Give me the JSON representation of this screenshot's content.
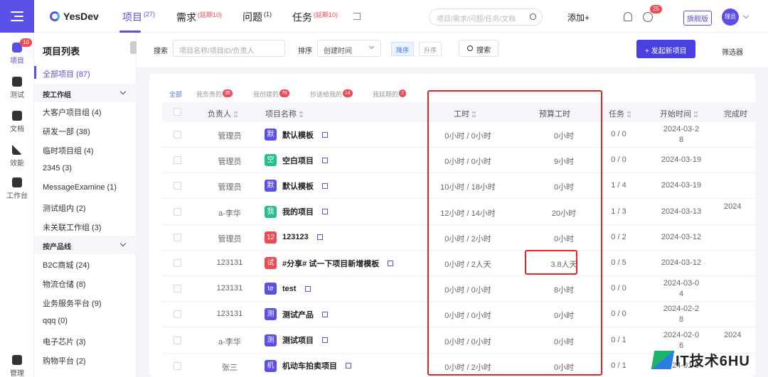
{
  "rail": {
    "project_badge": "10",
    "items": [
      {
        "label": "项目"
      },
      {
        "label": "测试"
      },
      {
        "label": "文档"
      },
      {
        "label": "效能"
      },
      {
        "label": "工作台"
      },
      {
        "label": "管理"
      }
    ]
  },
  "topbar": {
    "logo": "YesDev",
    "tabs": [
      {
        "label": "项目",
        "sup": "(27)"
      },
      {
        "label": "需求",
        "sup": "(延期10)"
      },
      {
        "label": "问题",
        "sup": "(1)"
      },
      {
        "label": "任务",
        "sup": "(延期10)"
      }
    ],
    "search_placeholder": "项目/需求/问题/任务/文档",
    "add_label": "添加+",
    "clock_badge": "25",
    "flagship_label": "旗舰版",
    "avatar_text": "理员"
  },
  "project_panel": {
    "title": "项目列表",
    "all_label": "全部项目 (87)",
    "group_work": "按工作组",
    "work_items": [
      "大客户项目组 (4)",
      "研发一部 (38)",
      "临时项目组 (4)",
      "2345 (3)",
      "MessageExamine (1)",
      "测试组内 (2)",
      "未关联工作组 (3)"
    ],
    "group_product": "按产品线",
    "product_items": [
      "B2C商城 (24)",
      "物流仓储 (8)",
      "业务服务平台 (9)",
      "qqq (0)",
      "电子芯片 (3)",
      "购物平台 (2)"
    ]
  },
  "filter": {
    "search_label": "搜索",
    "search_placeholder": "项目名称/项目ID/负责人",
    "sort_label": "排序",
    "sort_value": "创建时间",
    "desc_label": "降序",
    "asc_label": "升序",
    "search_button": "搜索",
    "new_project_button": "+ 发起新项目",
    "filter_label": "筛选器"
  },
  "subtabs": [
    {
      "label": "全部",
      "badge": ""
    },
    {
      "label": "我负责的",
      "badge": "35"
    },
    {
      "label": "我创建的",
      "badge": "76"
    },
    {
      "label": "抄送给我的",
      "badge": "14"
    },
    {
      "label": "我延期的",
      "badge": "2"
    }
  ],
  "table": {
    "headers": {
      "owner": "负责人",
      "name": "项目名称",
      "hours": "工时",
      "budget": "预算工时",
      "tasks": "任务",
      "start": "开始时间",
      "finish": "完成时"
    },
    "rows": [
      {
        "owner": "管理员",
        "icon": "默",
        "icon_color": "#5a4fe6",
        "name": "默认模板",
        "hours": "0小时 / 0小时",
        "budget": "0小时",
        "tasks": "0 / 0",
        "start1": "2024-03-2",
        "start2": "8",
        "finish": ""
      },
      {
        "owner": "管理员",
        "icon": "空",
        "icon_color": "#27c08a",
        "name": "空白项目",
        "hours": "0小时 / 0小时",
        "budget": "9小时",
        "tasks": "0 / 0",
        "start1": "2024-03-19",
        "start2": "",
        "finish": ""
      },
      {
        "owner": "管理员",
        "icon": "默",
        "icon_color": "#5a4fe6",
        "name": "默认模板",
        "hours": "10小时 / 18小时",
        "budget": "0小时",
        "tasks": "1 / 4",
        "start1": "2024-03-19",
        "start2": "",
        "finish": ""
      },
      {
        "owner": "a-李华",
        "icon": "我",
        "icon_color": "#27c08a",
        "name": "我的项目",
        "hours": "12小时 / 14小时",
        "budget": "20小时",
        "tasks": "1 / 3",
        "start1": "2024-03-13",
        "start2": "",
        "finish": "2024"
      },
      {
        "owner": "管理员",
        "icon": "12",
        "icon_color": "#f04b55",
        "name": "123123",
        "hours": "0小时 / 2小时",
        "budget": "0小时",
        "tasks": "0 / 2",
        "start1": "2024-03-12",
        "start2": "",
        "finish": ""
      },
      {
        "owner": "123131",
        "icon": "试",
        "icon_color": "#f04b55",
        "name": "#分享# 试一下项目新增模板",
        "hours": "0小时 / 2人天",
        "budget": "3.8人天",
        "tasks": "0 / 5",
        "start1": "2024-03-12",
        "start2": "",
        "finish": ""
      },
      {
        "owner": "123131",
        "icon": "te",
        "icon_color": "#5a4fe6",
        "name": "test",
        "hours": "0小时 / 0小时",
        "budget": "8小时",
        "tasks": "0 / 0",
        "start1": "2024-03-0",
        "start2": "4",
        "finish": ""
      },
      {
        "owner": "123131",
        "icon": "测",
        "icon_color": "#5a4fe6",
        "name": "测试产品",
        "hours": "0小时 / 0小时",
        "budget": "0小时",
        "tasks": "0 / 0",
        "start1": "2024-02-2",
        "start2": "8",
        "finish": ""
      },
      {
        "owner": "a-李华",
        "icon": "测",
        "icon_color": "#5a4fe6",
        "name": "测试项目",
        "hours": "0小时 / 0小时",
        "budget": "0小时",
        "tasks": "0 / 1",
        "start1": "2024-02-0",
        "start2": "6",
        "finish": "2024"
      },
      {
        "owner": "张三",
        "icon": "机",
        "icon_color": "#5a4fe6",
        "name": "机动车拍卖项目",
        "hours": "0小时 / 2小时",
        "budget": "0小时",
        "tasks": "0 / 1",
        "start1": "2024-01-0",
        "start2": "",
        "finish": ""
      }
    ]
  },
  "watermark": "IT技术6HU",
  "colors": {
    "accent": "#5a4fe6",
    "highlight": "#e3242b",
    "badge": "#f04b55"
  }
}
